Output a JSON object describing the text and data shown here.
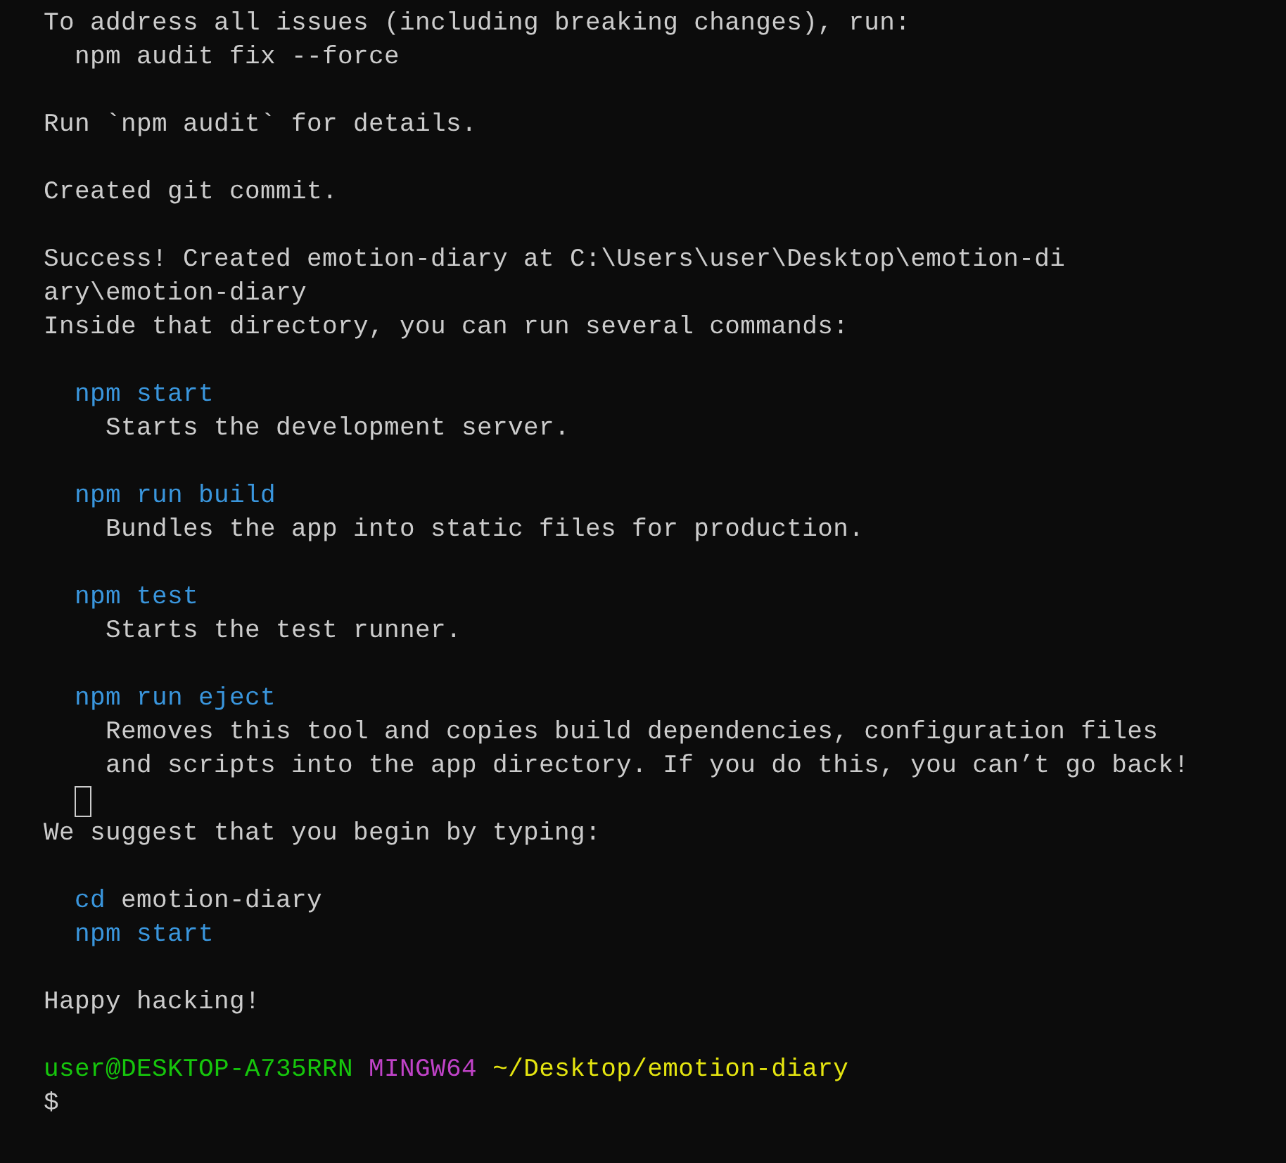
{
  "terminal": {
    "lines": [
      {
        "kind": "output",
        "segments": [
          {
            "kind": "plain",
            "text": "To address all issues (including breaking changes), run:"
          }
        ]
      },
      {
        "kind": "indented",
        "segments": [
          {
            "kind": "plain",
            "text": "npm audit fix --force"
          }
        ]
      },
      {
        "kind": "blank"
      },
      {
        "kind": "output",
        "segments": [
          {
            "kind": "plain",
            "text": "Run `npm audit` for details."
          }
        ]
      },
      {
        "kind": "blank"
      },
      {
        "kind": "output",
        "segments": [
          {
            "kind": "plain",
            "text": "Created git commit."
          }
        ]
      },
      {
        "kind": "blank"
      },
      {
        "kind": "output",
        "segments": [
          {
            "kind": "plain",
            "text": "Success! Created emotion-diary at C:\\Users\\user\\Desktop\\emotion-di"
          }
        ]
      },
      {
        "kind": "output",
        "segments": [
          {
            "kind": "plain",
            "text": "ary\\emotion-diary"
          }
        ]
      },
      {
        "kind": "output",
        "segments": [
          {
            "kind": "plain",
            "text": "Inside that directory, you can run several commands:"
          }
        ]
      },
      {
        "kind": "blank"
      },
      {
        "kind": "indented",
        "segments": [
          {
            "kind": "command",
            "text": "npm start"
          }
        ]
      },
      {
        "kind": "detail",
        "segments": [
          {
            "kind": "plain",
            "text": "Starts the development server."
          }
        ]
      },
      {
        "kind": "blank"
      },
      {
        "kind": "indented",
        "segments": [
          {
            "kind": "command",
            "text": "npm run build"
          }
        ]
      },
      {
        "kind": "detail",
        "segments": [
          {
            "kind": "plain",
            "text": "Bundles the app into static files for production."
          }
        ]
      },
      {
        "kind": "blank"
      },
      {
        "kind": "indented",
        "segments": [
          {
            "kind": "command",
            "text": "npm test"
          }
        ]
      },
      {
        "kind": "detail",
        "segments": [
          {
            "kind": "plain",
            "text": "Starts the test runner."
          }
        ]
      },
      {
        "kind": "blank"
      },
      {
        "kind": "indented",
        "segments": [
          {
            "kind": "command",
            "text": "npm run eject"
          }
        ]
      },
      {
        "kind": "detail",
        "segments": [
          {
            "kind": "plain",
            "text": "Removes this tool and copies build dependencies, configuration files"
          }
        ]
      },
      {
        "kind": "detail",
        "segments": [
          {
            "kind": "plain",
            "text": "and scripts into the app directory. If you do this, you can’t go back!"
          }
        ]
      },
      {
        "kind": "cursor"
      },
      {
        "kind": "output",
        "segments": [
          {
            "kind": "plain",
            "text": "We suggest that you begin by typing:"
          }
        ]
      },
      {
        "kind": "blank"
      },
      {
        "kind": "indented",
        "segments": [
          {
            "kind": "command",
            "text": "cd"
          },
          {
            "kind": "plain",
            "text": "emotion-diary"
          }
        ]
      },
      {
        "kind": "indented",
        "segments": [
          {
            "kind": "command",
            "text": "npm start"
          }
        ]
      },
      {
        "kind": "blank"
      },
      {
        "kind": "output",
        "segments": [
          {
            "kind": "plain",
            "text": "Happy hacking!"
          }
        ]
      },
      {
        "kind": "blank"
      },
      {
        "kind": "output",
        "segments": [
          {
            "kind": "user",
            "text": "user@DESKTOP-A735RRN"
          },
          {
            "kind": "host",
            "text": "MINGW64"
          },
          {
            "kind": "path",
            "text": "~/Desktop/emotion-diary"
          }
        ]
      },
      {
        "kind": "output",
        "segments": [
          {
            "kind": "plain",
            "text": "$"
          }
        ]
      }
    ]
  }
}
